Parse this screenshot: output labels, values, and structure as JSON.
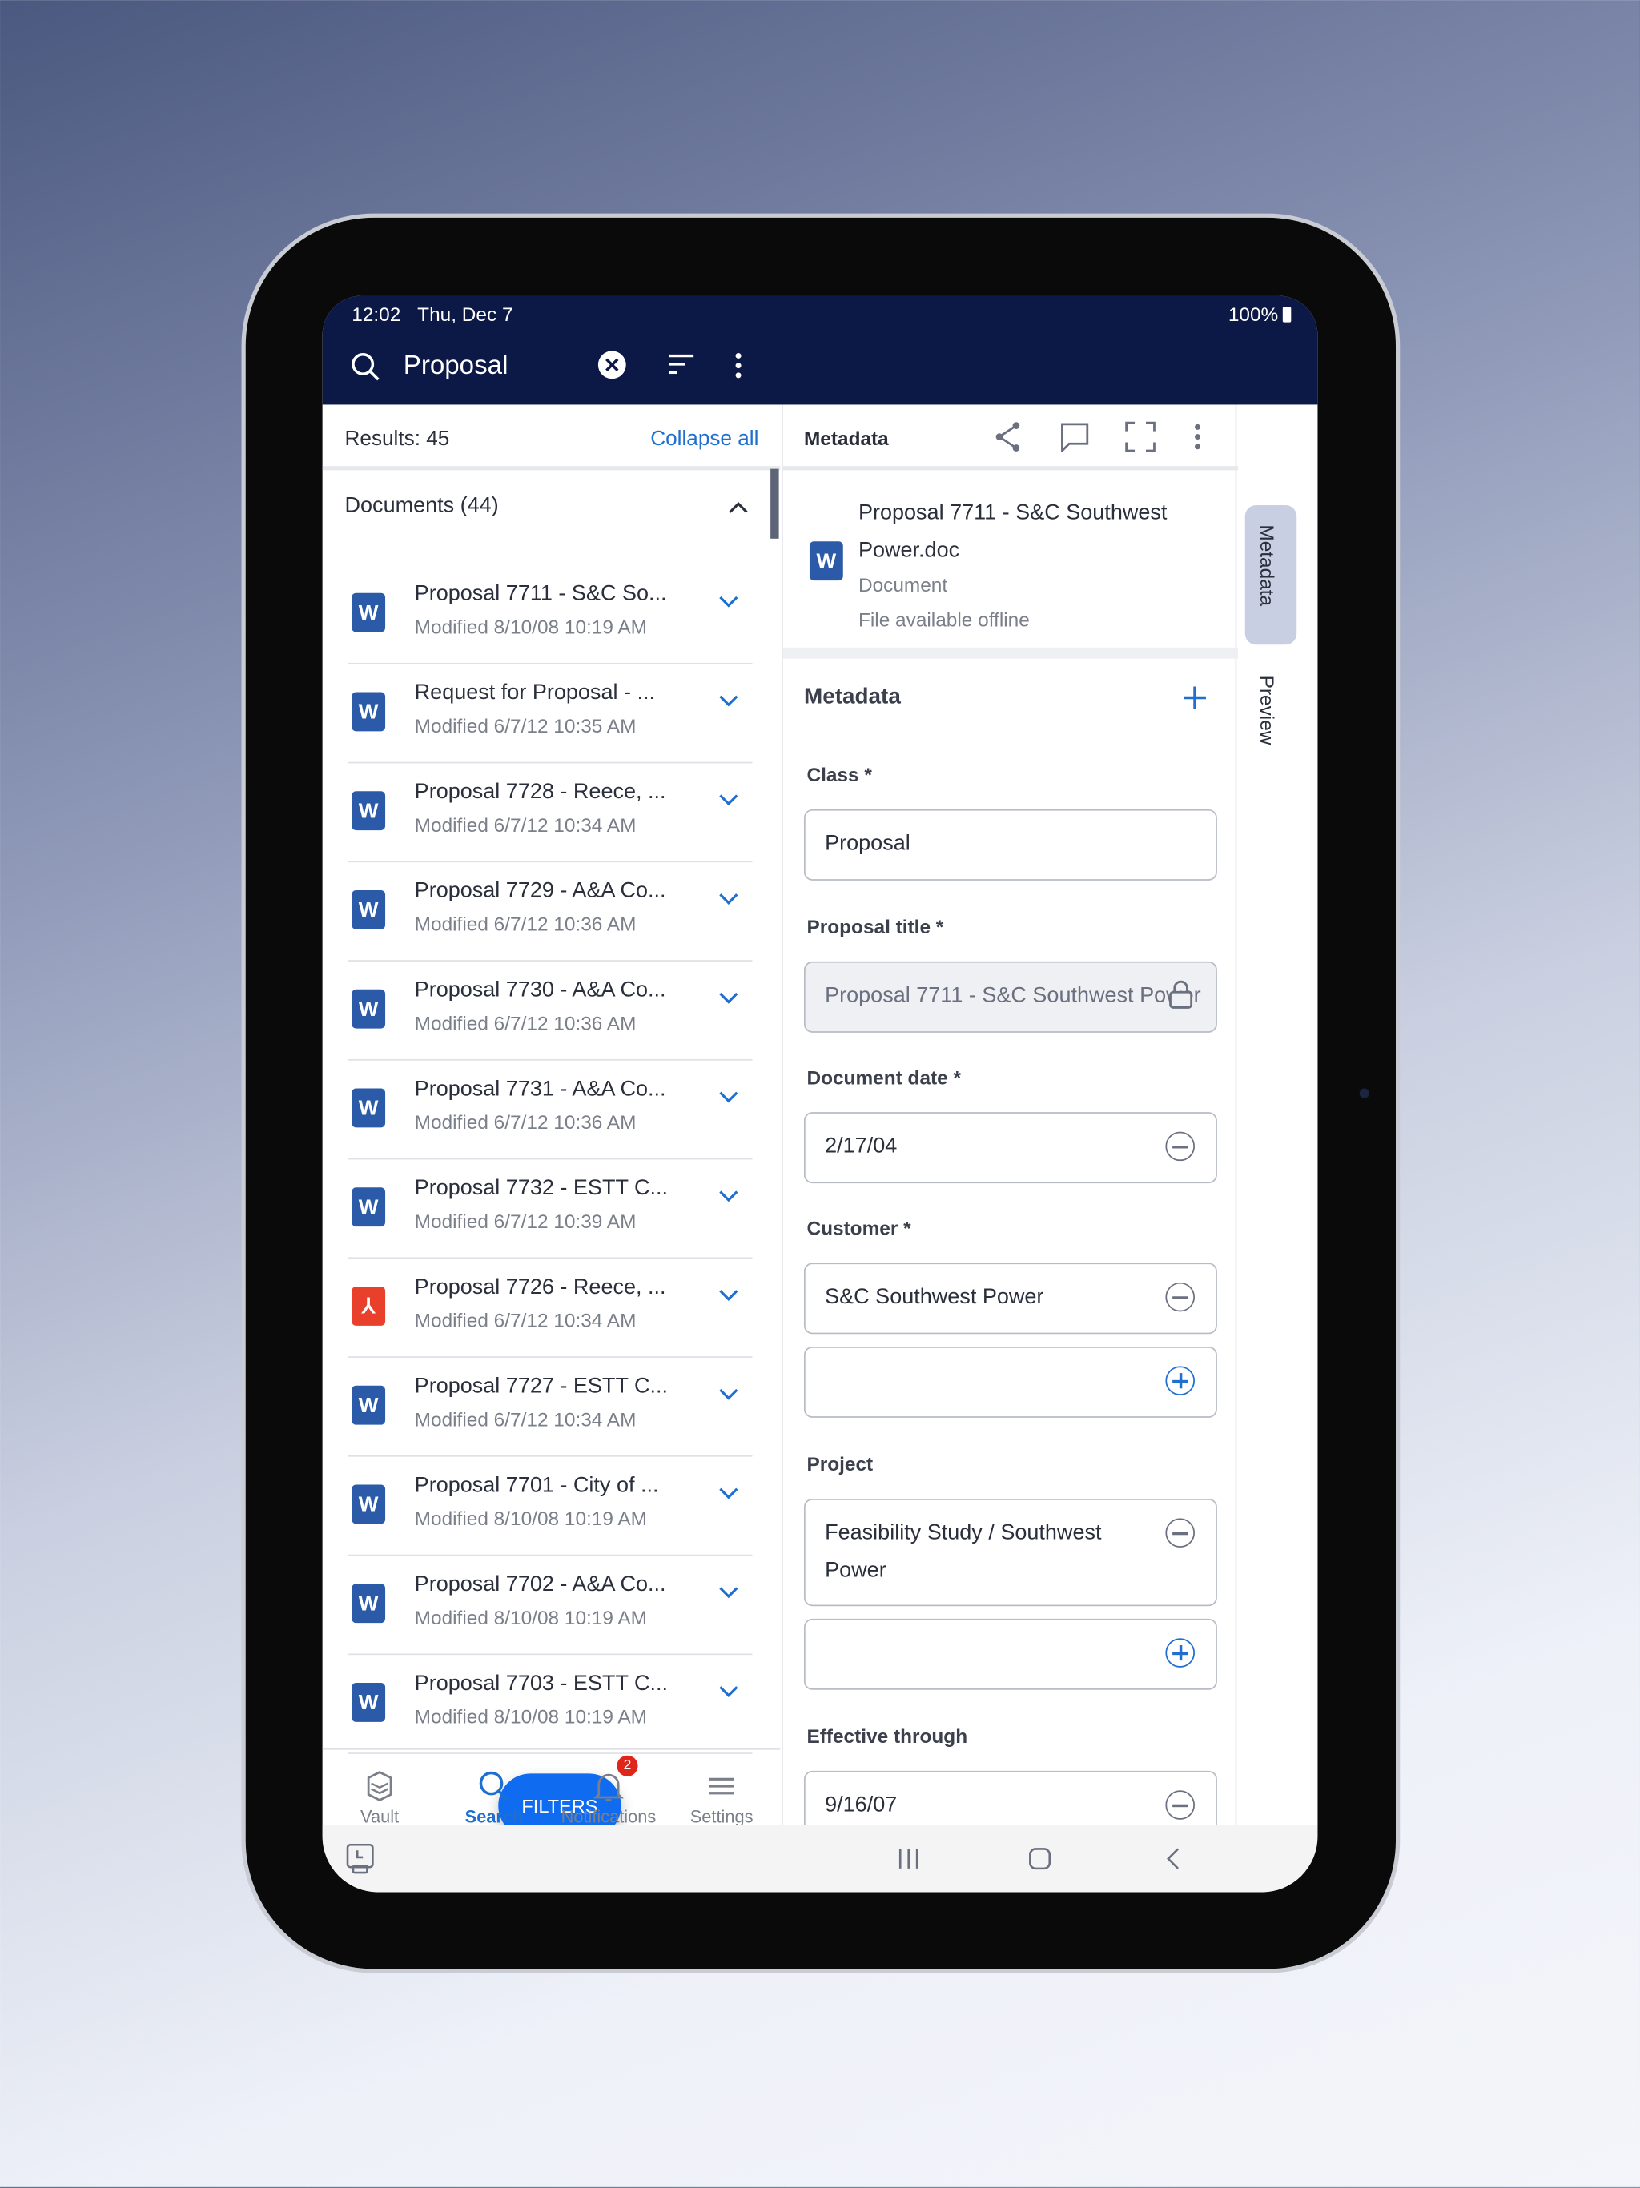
{
  "status_bar": {
    "time": "12:02",
    "date": "Thu, Dec 7",
    "battery": "100%"
  },
  "search": {
    "query": "Proposal"
  },
  "results": {
    "count_label": "Results: 45",
    "collapse_label": "Collapse all",
    "group_label": "Documents (44)"
  },
  "documents": [
    {
      "title": "Proposal 7711 - S&C So...",
      "modified": "Modified 8/10/08 10:19 AM",
      "type": "word"
    },
    {
      "title": "Request for Proposal - ...",
      "modified": "Modified 6/7/12 10:35 AM",
      "type": "word"
    },
    {
      "title": "Proposal 7728 - Reece, ...",
      "modified": "Modified 6/7/12 10:34 AM",
      "type": "word"
    },
    {
      "title": "Proposal 7729 - A&A Co...",
      "modified": "Modified 6/7/12 10:36 AM",
      "type": "word"
    },
    {
      "title": "Proposal 7730 - A&A Co...",
      "modified": "Modified 6/7/12 10:36 AM",
      "type": "word"
    },
    {
      "title": "Proposal 7731 - A&A Co...",
      "modified": "Modified 6/7/12 10:36 AM",
      "type": "word"
    },
    {
      "title": "Proposal 7732 - ESTT C...",
      "modified": "Modified 6/7/12 10:39 AM",
      "type": "word"
    },
    {
      "title": "Proposal 7726 - Reece, ...",
      "modified": "Modified 6/7/12 10:34 AM",
      "type": "pdf"
    },
    {
      "title": "Proposal 7727 - ESTT C...",
      "modified": "Modified 6/7/12 10:34 AM",
      "type": "word"
    },
    {
      "title": "Proposal 7701 - City of ...",
      "modified": "Modified 8/10/08 10:19 AM",
      "type": "word"
    },
    {
      "title": "Proposal 7702 - A&A Co...",
      "modified": "Modified 8/10/08 10:19 AM",
      "type": "word"
    },
    {
      "title": "Proposal 7703 - ESTT C...",
      "modified": "Modified 8/10/08 10:19 AM",
      "type": "word"
    }
  ],
  "filters_label": "FILTERS",
  "bottom_nav": [
    {
      "label": "Vault",
      "icon": "vault-icon"
    },
    {
      "label": "Search",
      "icon": "search-icon",
      "active": true
    },
    {
      "label": "Notifications",
      "icon": "bell-icon",
      "badge": "2"
    },
    {
      "label": "Settings",
      "icon": "menu-icon"
    }
  ],
  "detail": {
    "toolbar_title": "Metadata",
    "doc_title": "Proposal 7711 - S&C Southwest Power.doc",
    "doc_type": "Document",
    "doc_offline": "File available offline",
    "section_title": "Metadata",
    "fields": {
      "class_label": "Class *",
      "class_value": "Proposal",
      "title_label": "Proposal title *",
      "title_value": "Proposal 7711 - S&C Southwest Power",
      "date_label": "Document date *",
      "date_value": "2/17/04",
      "customer_label": "Customer *",
      "customer_value": "S&C Southwest Power",
      "project_label": "Project",
      "project_value": "Feasibility Study / Southwest Power",
      "effective_label": "Effective through",
      "effective_value": "9/16/07"
    }
  },
  "side_tabs": {
    "metadata": "Metadata",
    "preview": "Preview"
  },
  "colors": {
    "header": "#0c1947",
    "accent": "#1f6fd1",
    "fab": "#0f6cf0",
    "badge": "#e0261b",
    "word": "#2b5aa8",
    "pdf": "#e8402a"
  }
}
